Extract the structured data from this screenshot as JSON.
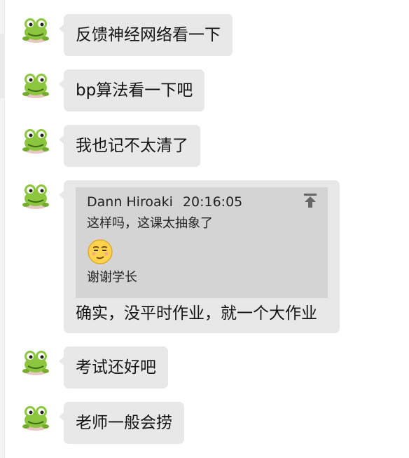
{
  "messages": [
    {
      "text": "反馈神经网络看一下"
    },
    {
      "text": "bp算法看一下吧"
    },
    {
      "text": "我也记不太清了"
    },
    {
      "text": "确实，没平时作业，就一个大作业",
      "quote": {
        "author": "Dann Hiroaki",
        "time": "20:16:05",
        "line1": "这样吗，这课太抽象了",
        "emoji": "smug-face-emoji",
        "line2": "谢谢学长"
      }
    },
    {
      "text": "考试还好吧"
    },
    {
      "text": "老师一般会捞"
    }
  ],
  "colors": {
    "bubble": "#e8e8e8",
    "quote_bg": "#d4d4d4",
    "avatar_green": "#8cc63f",
    "text": "#141414"
  }
}
